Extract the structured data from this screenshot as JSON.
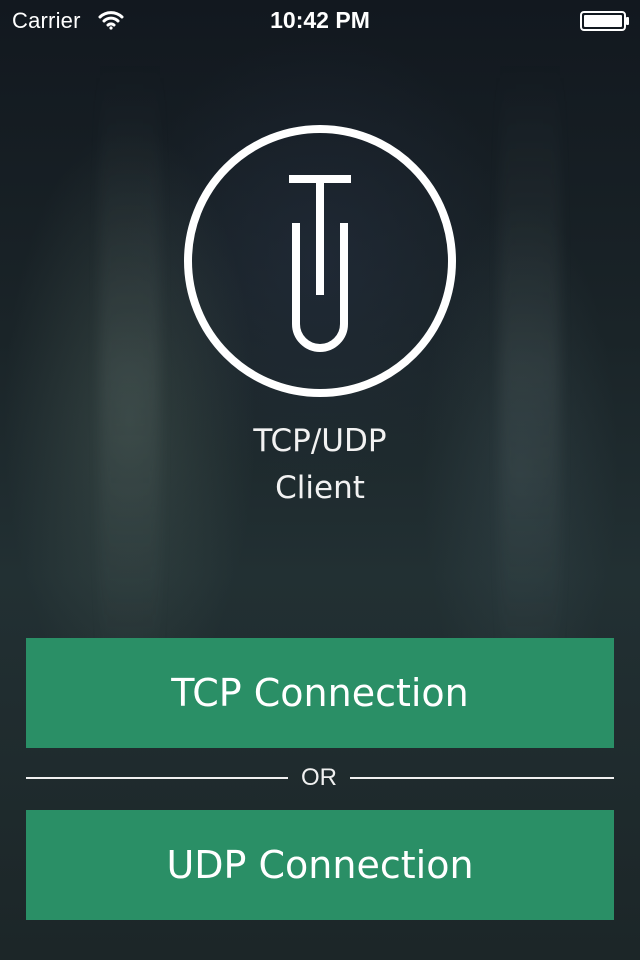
{
  "status_bar": {
    "carrier": "Carrier",
    "time": "10:42 PM",
    "wifi_icon": "wifi-icon",
    "battery_icon": "battery-icon"
  },
  "logo": {
    "icon": "tu-logo-icon",
    "letters": [
      "T",
      "U"
    ]
  },
  "app_name": {
    "line1": "TCP/UDP",
    "line2": "Client"
  },
  "buttons": {
    "tcp": "TCP Connection",
    "udp": "UDP Connection"
  },
  "divider": {
    "label": "OR"
  },
  "colors": {
    "button": "#2a8f66",
    "text": "#ffffff",
    "background": "#1b2326"
  }
}
